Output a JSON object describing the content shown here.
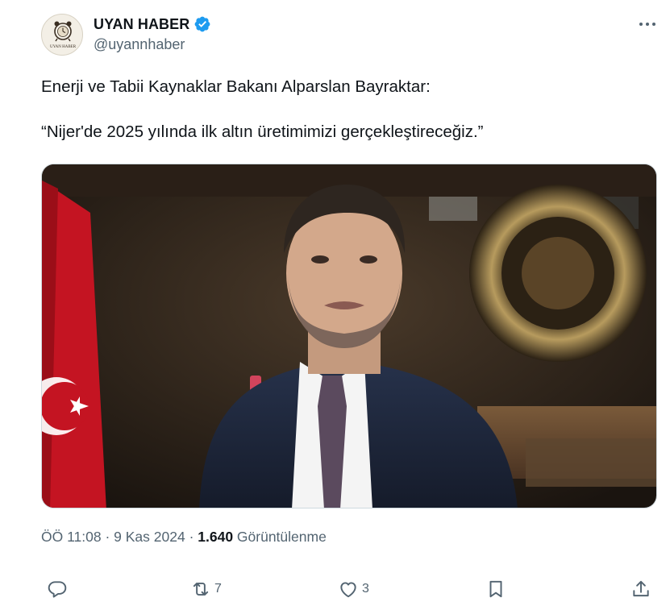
{
  "author": {
    "display_name": "UYAN HABER",
    "handle": "@uyannhaber",
    "avatar_text": "UYAN HABER",
    "verified": true
  },
  "tweet": {
    "line1": "Enerji ve Tabii Kaynaklar Bakanı Alparslan Bayraktar:",
    "line2": "“Nijer'de 2025 yılında ilk altın üretimimizi gerçekleştireceğiz.”"
  },
  "meta": {
    "time": "ÖÖ 11:08",
    "separator": " · ",
    "date": "9 Kas 2024",
    "views_count": "1.640",
    "views_label": " Görüntülenme"
  },
  "actions": {
    "reply_count": "",
    "retweet_count": "7",
    "like_count": "3"
  },
  "icons": [
    "verified-badge-icon",
    "more-icon",
    "reply-icon",
    "retweet-icon",
    "like-icon",
    "bookmark-icon",
    "share-icon"
  ],
  "colors": {
    "verified": "#1d9bf0",
    "secondary_text": "#536471",
    "text": "#0f1419"
  }
}
